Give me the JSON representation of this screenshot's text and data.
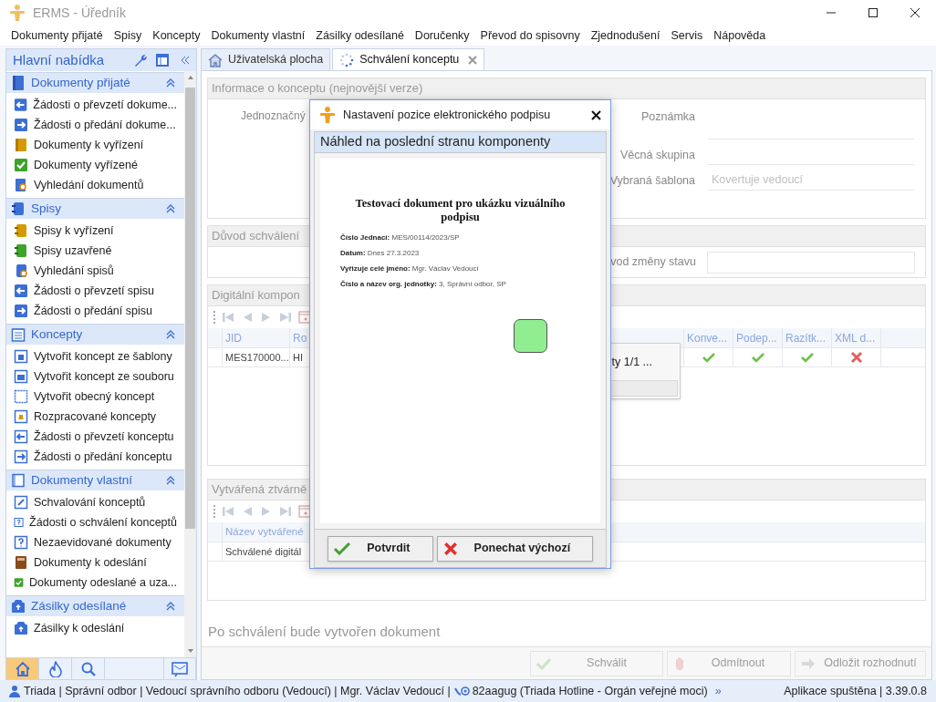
{
  "window": {
    "title": "ERMS - Úředník"
  },
  "menu": [
    "Dokumenty přijaté",
    "Spisy",
    "Koncepty",
    "Dokumenty vlastní",
    "Zásilky odesílané",
    "Doručenky",
    "Převod do spisovny",
    "Zjednodušení",
    "Servis",
    "Nápověda"
  ],
  "sidebar": {
    "title": "Hlavní nabídka",
    "sections": [
      {
        "title": "Dokumenty přijaté",
        "expanded": true,
        "items": [
          "Žádosti o převzetí dokume...",
          "Žádosti o předání dokume...",
          "Dokumenty k vyřízení",
          "Dokumenty vyřízené",
          "Vyhledání dokumentů"
        ]
      },
      {
        "title": "Spisy",
        "expanded": true,
        "items": [
          "Spisy k vyřízení",
          "Spisy uzavřené",
          "Vyhledání spisů",
          "Žádosti o převzetí spisu",
          "Žádosti o předání spisu"
        ]
      },
      {
        "title": "Koncepty",
        "expanded": true,
        "items": [
          "Vytvořit koncept ze šablony",
          "Vytvořit koncept ze souboru",
          "Vytvořit obecný koncept",
          "Rozpracované koncepty",
          "Žádosti o převzetí konceptu",
          "Žádosti o předání konceptu"
        ]
      },
      {
        "title": "Dokumenty vlastní",
        "expanded": true,
        "items": [
          "Schvalování konceptů",
          "Žádosti o schválení konceptů",
          "Nezaevidované dokumenty",
          "Dokumenty k odeslání",
          "Dokumenty odeslané a uza..."
        ]
      },
      {
        "title": "Zásilky odesílané",
        "expanded": true,
        "items": [
          "Zásilky k odeslání"
        ]
      }
    ],
    "toolbar": [
      {
        "selected": true
      },
      {
        "selected": false
      },
      {
        "selected": false
      },
      {
        "selected": false
      }
    ]
  },
  "tabs": [
    {
      "label": "Uživatelská plocha",
      "selected": false
    },
    {
      "label": "Schválení konceptu",
      "selected": true
    }
  ],
  "info": {
    "title": "Informace o konceptu (nejnovější verze)",
    "left_label": "Jednoznačný",
    "fields": [
      {
        "label": "Poznámka",
        "kind": "textarea"
      },
      {
        "label": "Věcná skupina",
        "kind": "input"
      },
      {
        "label": "Vybraná šablona",
        "kind": "input",
        "placeholder": "Kovertuje vedoucí"
      }
    ]
  },
  "reason": {
    "title": "Důvod schválení",
    "field_label": "vod změny stavu"
  },
  "components": {
    "title": "Digitální kompon",
    "columns": [
      "JID",
      "Ro",
      "Konve...",
      "Podep...",
      "Razítk...",
      "XML d..."
    ],
    "rows": [
      {
        "cells": [
          "MES170000...",
          "HI"
        ],
        "flags": [
          true,
          true,
          true,
          false
        ]
      }
    ]
  },
  "popup": {
    "text": "ty 1/1 ..."
  },
  "renditions": {
    "title": "Vytvářená ztvárně",
    "columns": [
      "Název vytvářené"
    ],
    "rows": [
      [
        "Schválené digitál"
      ]
    ]
  },
  "note": "Po schválení bude vytvořen dokument",
  "actions": [
    {
      "label": "Schválit",
      "disabled": true
    },
    {
      "label": "Odmítnout",
      "disabled": true
    },
    {
      "label": "Odložit rozhodnutí",
      "disabled": true
    }
  ],
  "status": {
    "user": "Triada | Správní odbor | Vedoucí správního odboru (Vedoucí) | Mgr. Václav Vedoucí |",
    "mailbox": "82aagug (Triada Hotline - Orgán veřejné moci)",
    "more": "»",
    "app": "Aplikace spuštěna | 3.39.0.8"
  },
  "dialog": {
    "title": "Nastavení pozice elektronického podpisu",
    "subtitle": "Náhled na poslední stranu komponenty",
    "document": {
      "title": "Testovací dokument pro ukázku vizuálního podpisu",
      "fields": [
        {
          "label": "Číslo Jednací:",
          "value": "MES/00114/2023/SP"
        },
        {
          "label": "Datum:",
          "value": "Dnes 27.3.2023"
        },
        {
          "label": "Vyřizuje celé jméno:",
          "value": "Mgr. Václav Vedoucí"
        },
        {
          "label": "Číslo a název org. jednotky:",
          "value": "3, Správní odbor, SP"
        }
      ]
    },
    "buttons": [
      {
        "label": "Potvrdit",
        "kind": "confirm"
      },
      {
        "label": "Ponechat výchozí",
        "kind": "cancel"
      }
    ]
  }
}
